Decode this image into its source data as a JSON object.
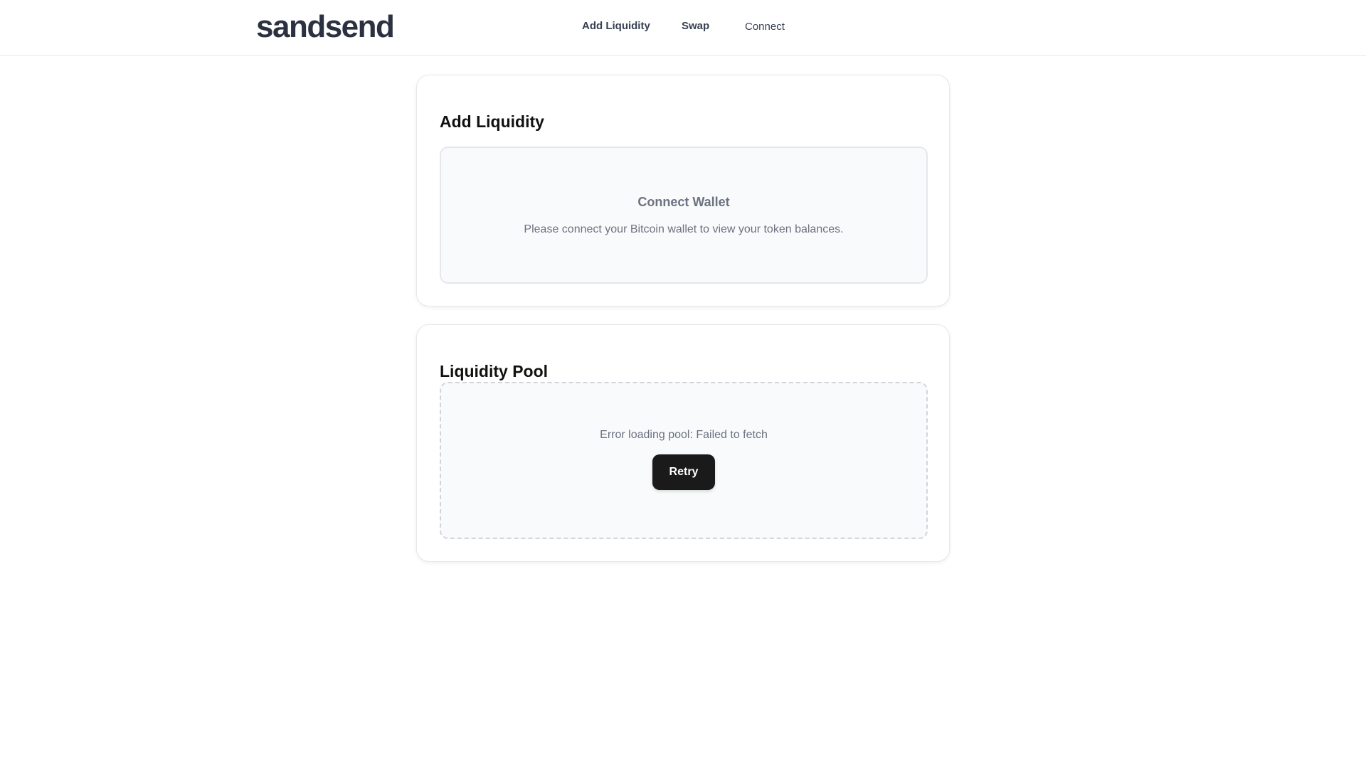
{
  "header": {
    "logo": "sandsend",
    "nav": {
      "add_liquidity": "Add Liquidity",
      "swap": "Swap",
      "connect": "Connect"
    }
  },
  "add_liquidity_card": {
    "title": "Add Liquidity",
    "wallet_prompt": {
      "title": "Connect Wallet",
      "message": "Please connect your Bitcoin wallet to view your token balances."
    }
  },
  "liquidity_pool_card": {
    "title": "Liquidity Pool",
    "error_message": "Error loading pool: Failed to fetch",
    "retry_label": "Retry"
  },
  "colors": {
    "logo": "#2b3140",
    "button_bg": "#1a1a1a",
    "muted_text": "#6b7280",
    "panel_bg": "#f9fafb",
    "border": "#e5e7eb"
  }
}
